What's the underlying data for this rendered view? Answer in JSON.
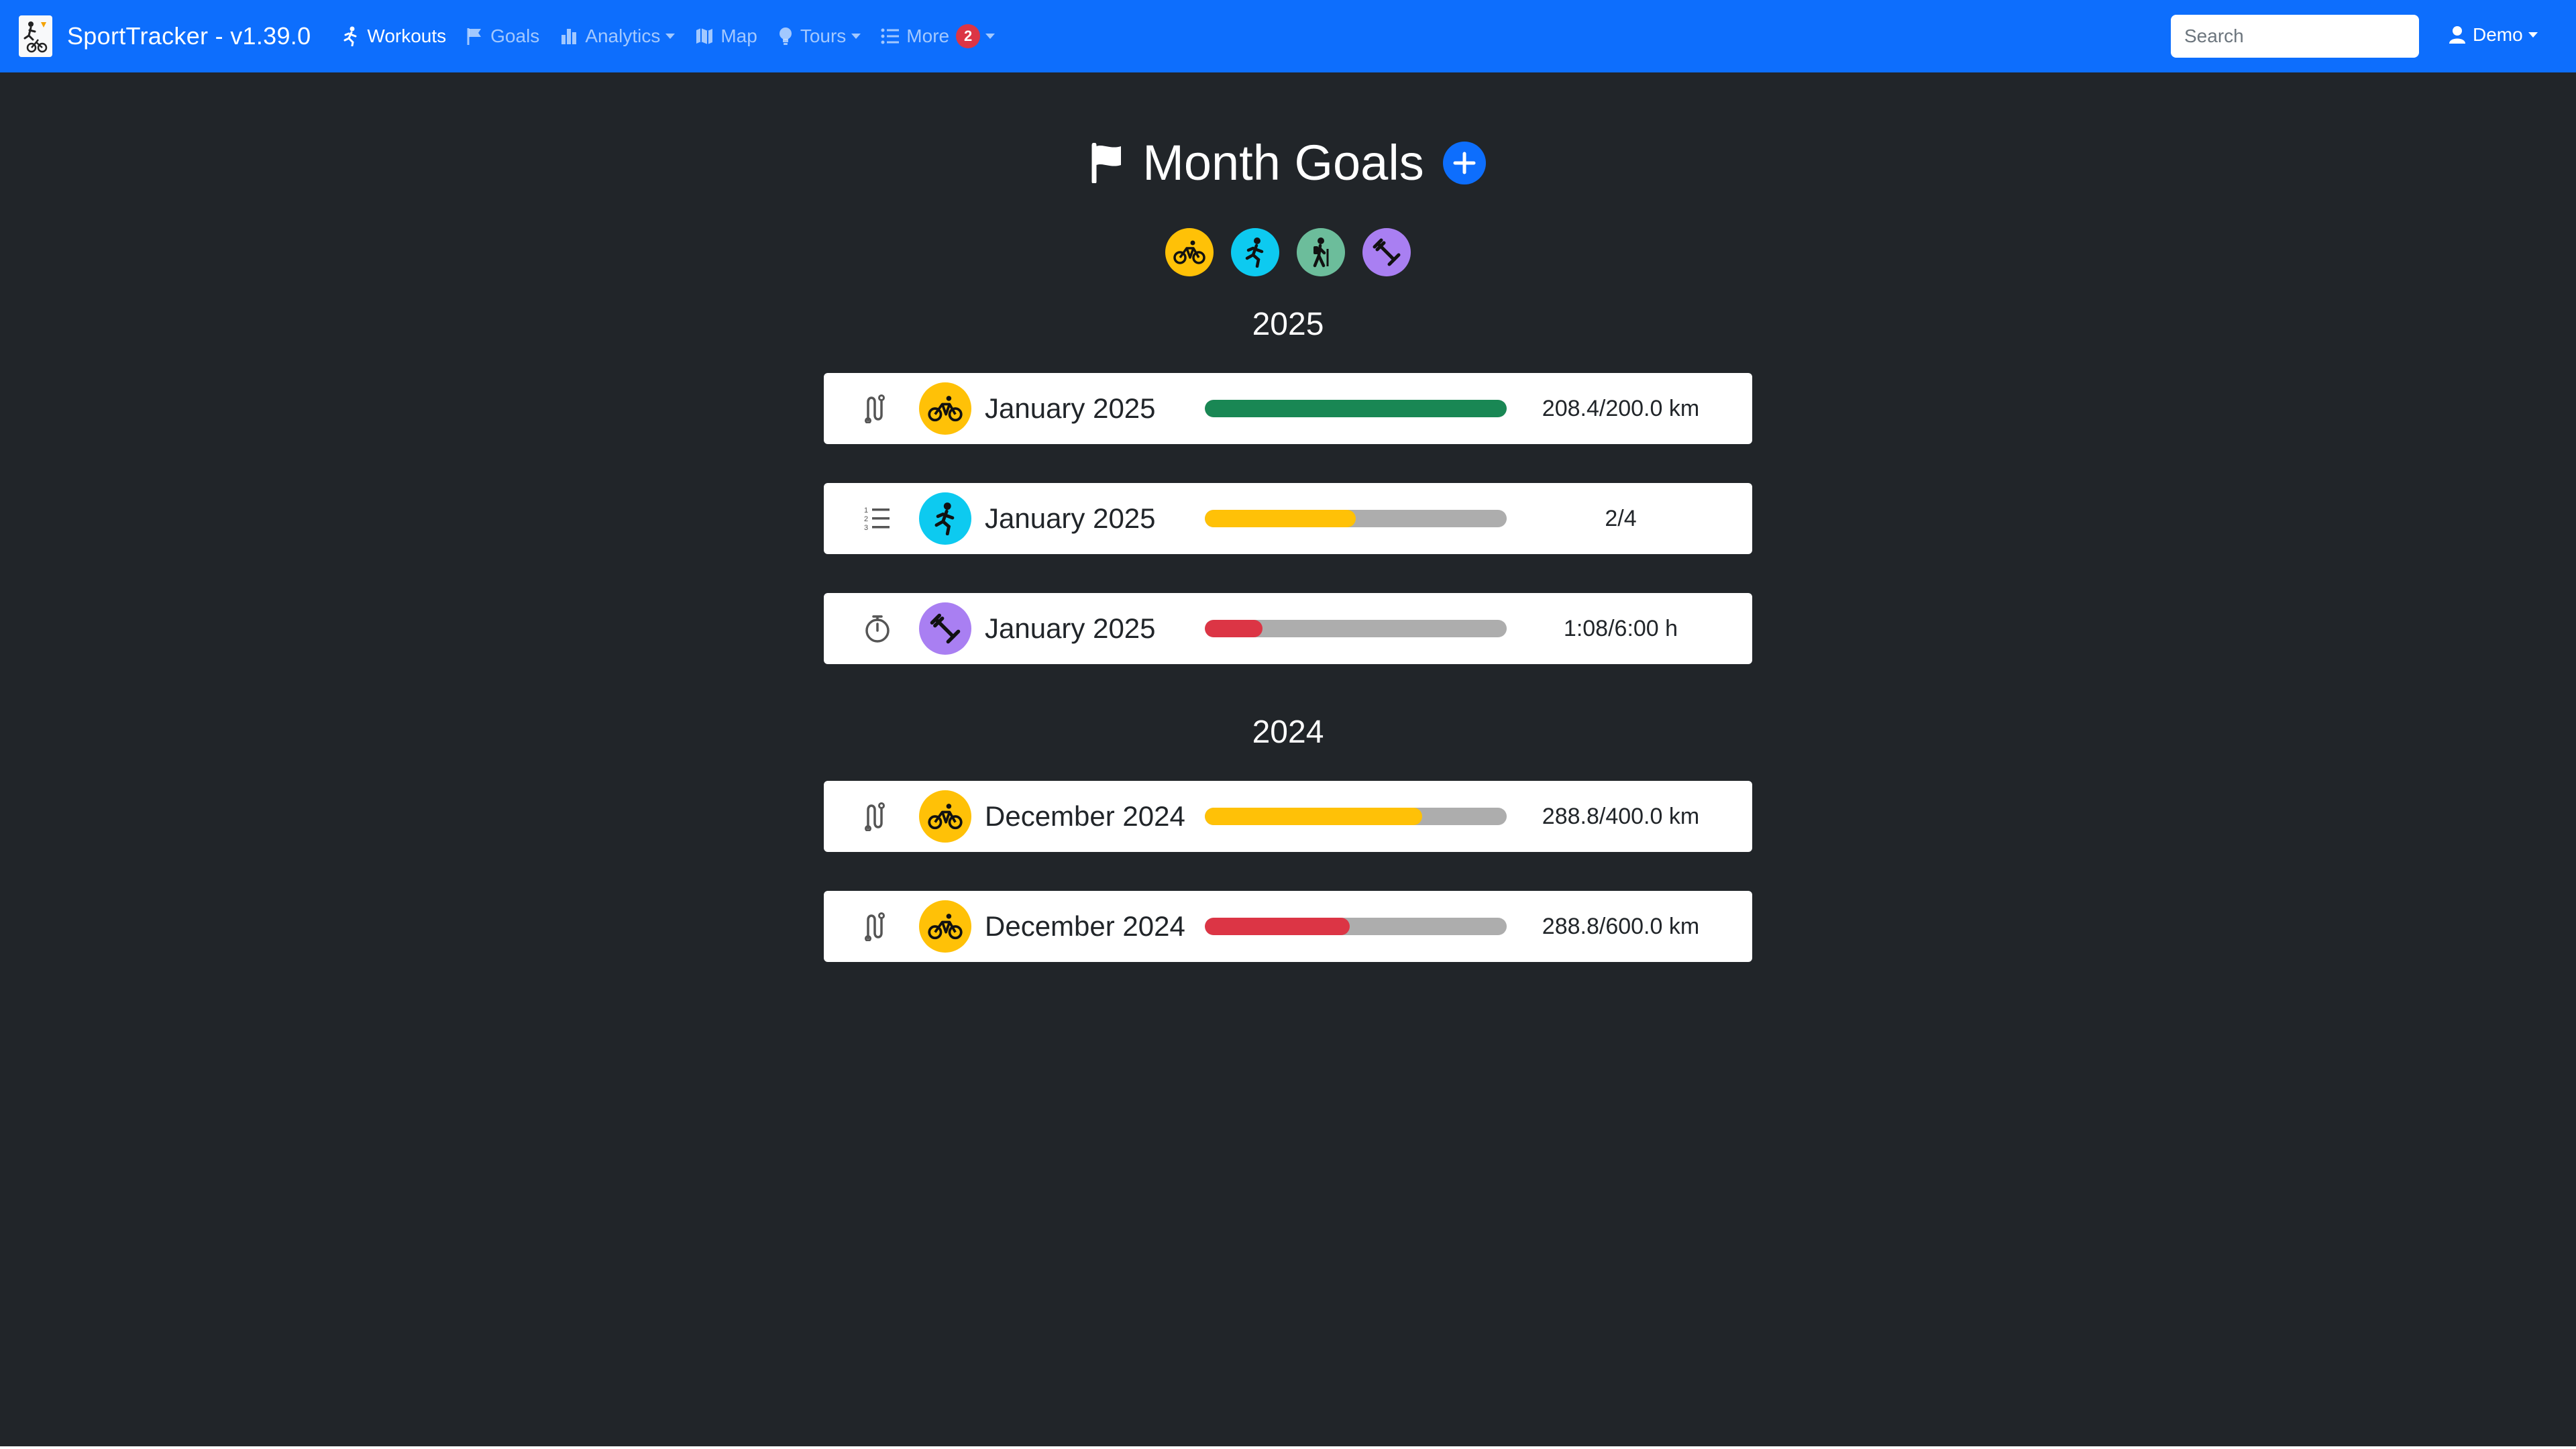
{
  "navbar": {
    "brand_title": "SportTracker - v1.39.0",
    "items": [
      {
        "label": "Workouts",
        "icon": "running-icon",
        "active": true
      },
      {
        "label": "Goals",
        "icon": "flag-icon"
      },
      {
        "label": "Analytics",
        "icon": "bar-chart-icon",
        "dropdown": true
      },
      {
        "label": "Map",
        "icon": "map-icon"
      },
      {
        "label": "Tours",
        "icon": "lightbulb-icon",
        "dropdown": true
      },
      {
        "label": "More",
        "icon": "list-icon",
        "dropdown": true,
        "badge": "2"
      }
    ],
    "search_placeholder": "Search",
    "user_label": "Demo"
  },
  "page": {
    "title": "Month Goals",
    "sport_filters": [
      {
        "sport": "cycling",
        "icon": "bicycle-icon",
        "color": "#ffc107"
      },
      {
        "sport": "running",
        "icon": "running-icon",
        "color": "#0dcaf0"
      },
      {
        "sport": "hiking",
        "icon": "hiking-icon",
        "color": "#6cbd9b"
      },
      {
        "sport": "fitness",
        "icon": "dumbbell-icon",
        "color": "#a97ff2"
      }
    ]
  },
  "groups": [
    {
      "year": "2025",
      "goals": [
        {
          "type_icon": "route-icon",
          "sport_icon": "bicycle-icon",
          "sport_color": "#ffc107",
          "label": "January 2025",
          "progress": 1.0,
          "bar_color": "#198754",
          "value": "208.4/200.0 km"
        },
        {
          "type_icon": "count-list-icon",
          "sport_icon": "running-icon",
          "sport_color": "#0dcaf0",
          "label": "January 2025",
          "progress": 0.5,
          "bar_color": "#ffc107",
          "value": "2/4"
        },
        {
          "type_icon": "stopwatch-icon",
          "sport_icon": "dumbbell-icon",
          "sport_color": "#a97ff2",
          "label": "January 2025",
          "progress": 0.19,
          "bar_color": "#dc3545",
          "value": "1:08/6:00 h"
        }
      ]
    },
    {
      "year": "2024",
      "goals": [
        {
          "type_icon": "route-icon",
          "sport_icon": "bicycle-icon",
          "sport_color": "#ffc107",
          "label": "December 2024",
          "progress": 0.72,
          "bar_color": "#ffc107",
          "value": "288.8/400.0 km"
        },
        {
          "type_icon": "route-icon",
          "sport_icon": "bicycle-icon",
          "sport_color": "#ffc107",
          "label": "December 2024",
          "progress": 0.48,
          "bar_color": "#dc3545",
          "value": "288.8/600.0 km"
        }
      ]
    }
  ]
}
